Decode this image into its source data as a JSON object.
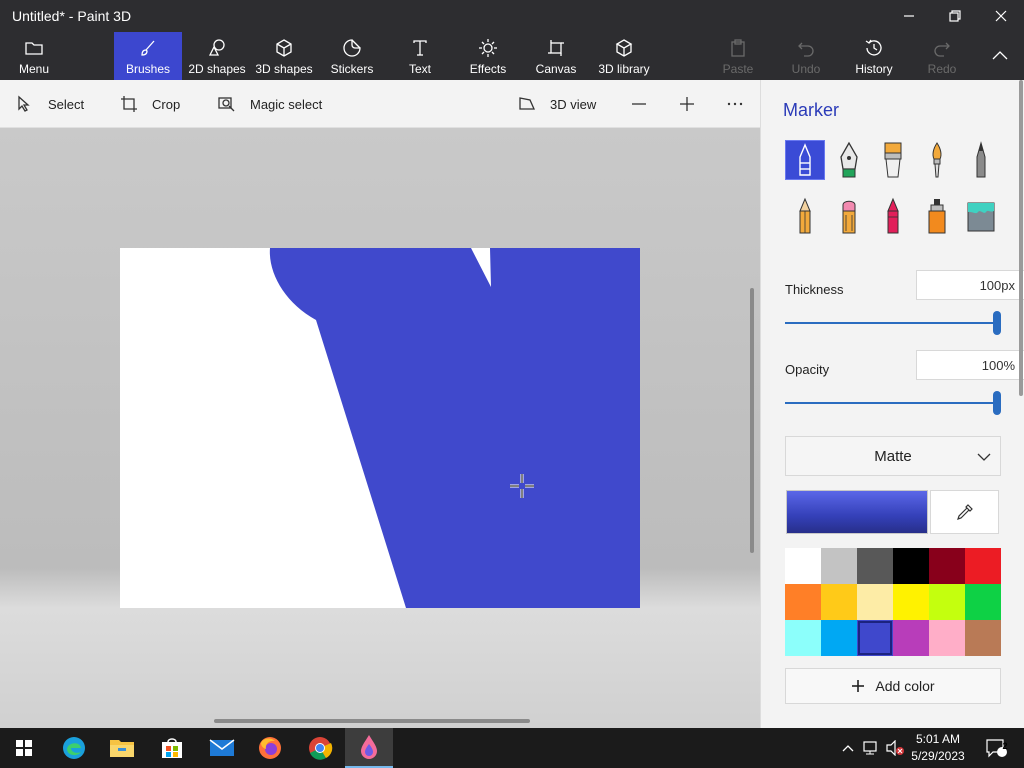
{
  "window": {
    "title": "Untitled* - Paint 3D"
  },
  "ribbon": {
    "menu": "Menu",
    "brushes": "Brushes",
    "shapes2d": "2D shapes",
    "shapes3d": "3D shapes",
    "stickers": "Stickers",
    "text": "Text",
    "effects": "Effects",
    "canvas": "Canvas",
    "library3d": "3D library",
    "paste": "Paste",
    "undo": "Undo",
    "history": "History",
    "redo": "Redo"
  },
  "subtoolbar": {
    "select": "Select",
    "crop": "Crop",
    "magic_select": "Magic select",
    "view3d": "3D view"
  },
  "panel": {
    "title": "Marker",
    "brushes": [
      "marker",
      "calligraphy-pen",
      "oil-brush",
      "watercolor",
      "pixel-pen",
      "pencil",
      "eraser",
      "crayon",
      "spray-can",
      "fill"
    ],
    "selected_brush": "marker",
    "thickness_label": "Thickness",
    "thickness_value": "100px",
    "thickness_level": 1.0,
    "opacity_label": "Opacity",
    "opacity_value": "100%",
    "opacity_level": 1.0,
    "finish": "Matte",
    "add_color": "Add color",
    "current_color": "#3f48cc",
    "swatches": [
      "#ffffff",
      "#c3c3c3",
      "#585858",
      "#000000",
      "#88001b",
      "#ec1c24",
      "#ff7f27",
      "#ffca18",
      "#fdeca6",
      "#fff200",
      "#c4ff0e",
      "#0ed145",
      "#8cfffb",
      "#00a8f3",
      "#3f48cc",
      "#b83dba",
      "#ffaec8",
      "#b97a56"
    ],
    "selected_swatch": 14
  },
  "taskbar": {
    "time": "5:01 AM",
    "date": "5/29/2023",
    "notification_count": "2",
    "apps": [
      "edge",
      "file-explorer",
      "microsoft-store",
      "mail",
      "firefox",
      "chrome",
      "paint-3d"
    ]
  }
}
